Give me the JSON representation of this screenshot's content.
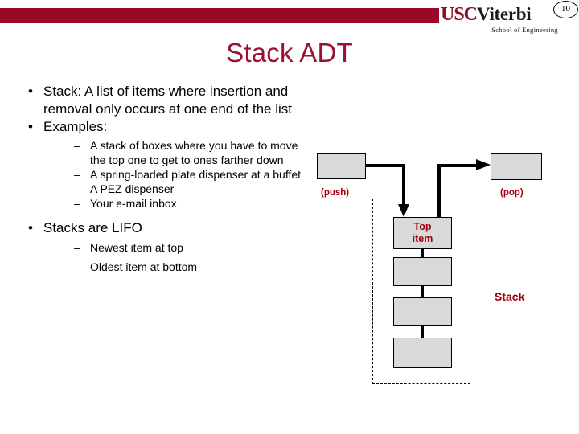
{
  "header": {
    "logo_usc": "USC",
    "logo_viterbi": "Viterbi",
    "logo_subtitle": "School of Engineering",
    "slide_number": "10",
    "bar_color": "#9b0726"
  },
  "title": "Stack ADT",
  "title_color": "#9b1130",
  "bullets": [
    {
      "level": 1,
      "marker": "•",
      "text": "Stack: A list of items where insertion and removal only occurs at one end of the list"
    },
    {
      "level": 1,
      "marker": "•",
      "text": "Examples:",
      "children": [
        {
          "level": 2,
          "marker": "–",
          "text": "A stack of boxes where you have to move the top one to get to ones farther down"
        },
        {
          "level": 2,
          "marker": "–",
          "text": "A spring-loaded plate dispenser at a buffet"
        },
        {
          "level": 2,
          "marker": "–",
          "text": "A PEZ dispenser"
        },
        {
          "level": 2,
          "marker": "–",
          "text": "Your e-mail inbox"
        }
      ]
    },
    {
      "level": 1,
      "marker": "•",
      "text": "Stacks are LIFO",
      "children": [
        {
          "level": 2,
          "marker": "–",
          "text": "Newest item at top"
        },
        {
          "level": 2,
          "marker": "–",
          "text": "Oldest item at bottom"
        }
      ]
    }
  ],
  "diagram": {
    "accent_color": "#a00010",
    "box_fill": "#d9d9d9",
    "push_label": "(push)",
    "pop_label": "(pop)",
    "stack_label": "Stack",
    "top_item_line1": "Top",
    "top_item_line2": "item",
    "stack_items": [
      {
        "label_line1": "Top",
        "label_line2": "item"
      },
      {
        "label_line1": "",
        "label_line2": ""
      },
      {
        "label_line1": "",
        "label_line2": ""
      },
      {
        "label_line1": "",
        "label_line2": ""
      }
    ]
  }
}
